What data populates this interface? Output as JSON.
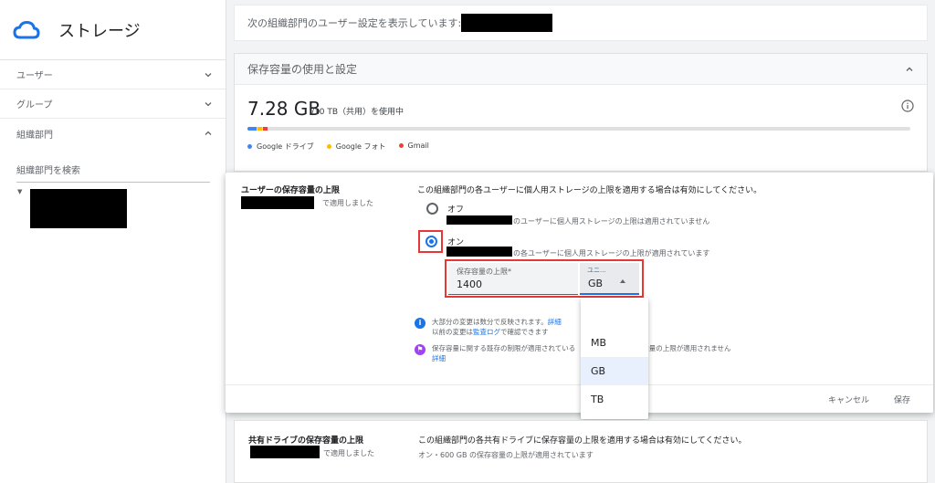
{
  "app": {
    "title": "ストレージ",
    "logo_icon": "cloud-icon"
  },
  "sidebar": {
    "items": [
      {
        "label": "ユーザー",
        "chevron": "chevron-down"
      },
      {
        "label": "グループ",
        "chevron": "chevron-down"
      },
      {
        "label": "組織部門",
        "chevron": "chevron-up"
      }
    ],
    "search_label": "組織部門を検索"
  },
  "org_bar": {
    "text": "次の組織部門のユーザー設定を表示しています:"
  },
  "storage_card": {
    "title": "保存容量の使用と設定",
    "used": "7.28 GB",
    "total": "/10 TB（共用）を使用中",
    "usage_fraction": 0.00073,
    "legend": [
      {
        "label": "Google ドライブ",
        "color": "#4285f4"
      },
      {
        "label": "Google フォト",
        "color": "#fbbc04"
      },
      {
        "label": "Gmail",
        "color": "#ea4335"
      }
    ]
  },
  "user_limit": {
    "title": "ユーザーの保存容量の上限",
    "applied_suffix": "で適用しました",
    "description": "この組織部門の各ユーザーに個人用ストレージの上限を適用する場合は有効にしてください。",
    "option_off": {
      "label": "オフ",
      "desc": "のユーザーに個人用ストレージの上限は適用されていません"
    },
    "option_on": {
      "label": "オン",
      "desc": "の各ユーザーに個人用ストレージの上限が適用されています",
      "selected": true
    },
    "limit_field": {
      "label": "保存容量の上限*",
      "value": "1400"
    },
    "unit_field": {
      "label": "ユニ...",
      "value": "GB"
    },
    "note1_line1": "大部分の変更は数分で反映されます。",
    "note1_link1": "詳細",
    "note1_line2_pre": "以前の変更は",
    "note1_link2": "監査ログ",
    "note1_line2_post": "で確認できます",
    "note2_pre": "保存容量に関する既存の制限が適用されている",
    "note2_post": "容量の上限が適用されません",
    "note2_link": "詳細",
    "cancel": "キャンセル",
    "save": "保存"
  },
  "unit_dropdown": {
    "options": [
      "MB",
      "GB",
      "TB"
    ],
    "selected": "GB"
  },
  "shared_drive_limit": {
    "title": "共有ドライブの保存容量の上限",
    "applied_suffix": "で適用しました",
    "description": "この組織部門の各共有ドライブに保存容量の上限を適用する場合は有効にしてください。",
    "status": "オン・600 GB の保存容量の上限が適用されています"
  }
}
